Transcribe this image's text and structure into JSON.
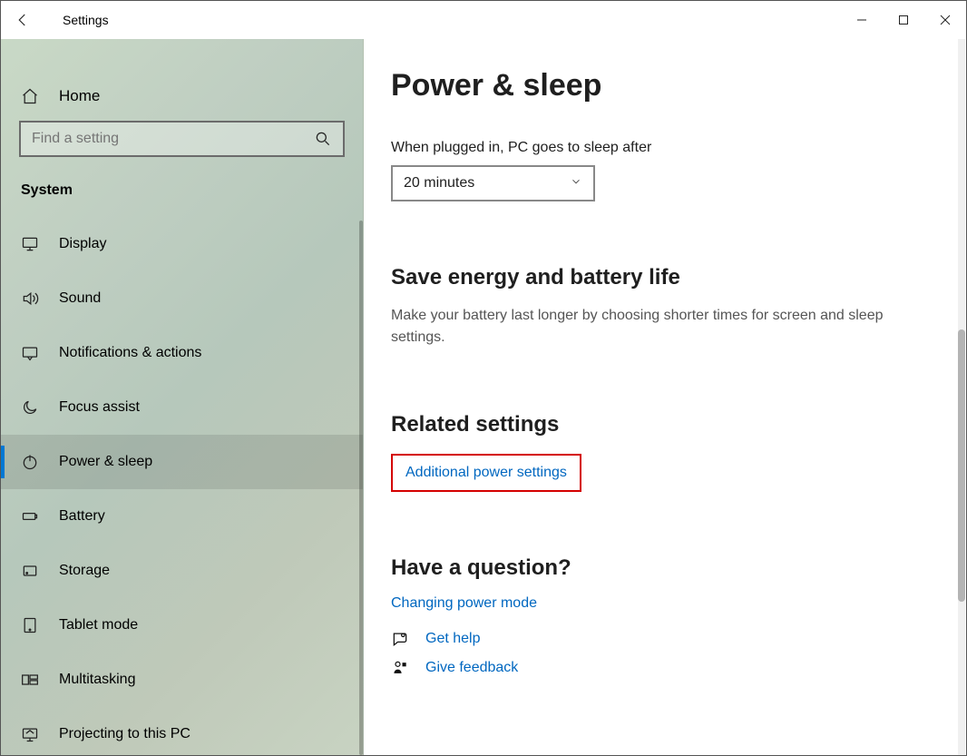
{
  "window": {
    "title": "Settings"
  },
  "sidebar": {
    "home": "Home",
    "search_placeholder": "Find a setting",
    "section": "System",
    "items": [
      {
        "key": "display",
        "label": "Display"
      },
      {
        "key": "sound",
        "label": "Sound"
      },
      {
        "key": "notifications",
        "label": "Notifications & actions"
      },
      {
        "key": "focus-assist",
        "label": "Focus assist"
      },
      {
        "key": "power-sleep",
        "label": "Power & sleep",
        "selected": true
      },
      {
        "key": "battery",
        "label": "Battery"
      },
      {
        "key": "storage",
        "label": "Storage"
      },
      {
        "key": "tablet-mode",
        "label": "Tablet mode"
      },
      {
        "key": "multitasking",
        "label": "Multitasking"
      },
      {
        "key": "projecting",
        "label": "Projecting to this PC"
      }
    ]
  },
  "main": {
    "heading": "Power & sleep",
    "sleep_label": "When plugged in, PC goes to sleep after",
    "sleep_value": "20 minutes",
    "energy_heading": "Save energy and battery life",
    "energy_desc": "Make your battery last longer by choosing shorter times for screen and sleep settings.",
    "related_heading": "Related settings",
    "related_link": "Additional power settings",
    "question_heading": "Have a question?",
    "question_link": "Changing power mode",
    "get_help": "Get help",
    "give_feedback": "Give feedback"
  }
}
